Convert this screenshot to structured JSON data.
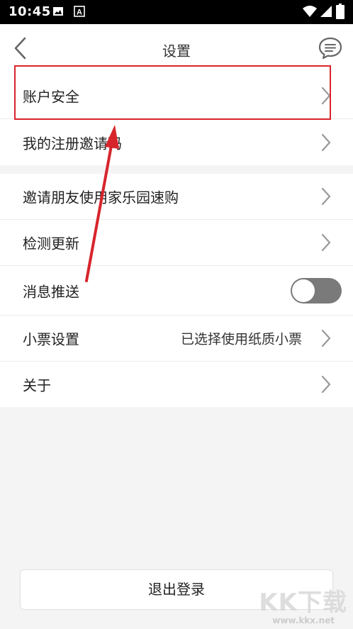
{
  "status_bar": {
    "time": "10:45",
    "icons": [
      "image-icon",
      "app-a-icon",
      "wifi-icon",
      "signal-icon",
      "battery-icon"
    ]
  },
  "header": {
    "title": "设置",
    "back_icon": "chevron-left-icon",
    "message_icon": "message-bubble-icon"
  },
  "settings": {
    "account_security": "账户安全",
    "invite_code": "我的注册邀请码",
    "invite_friends": "邀请朋友使用家乐园速购",
    "check_update": "检测更新",
    "push_notifications": "消息推送",
    "push_enabled": false,
    "receipt_settings": "小票设置",
    "receipt_value": "已选择使用纸质小票",
    "about": "关于"
  },
  "logout_label": "退出登录",
  "watermark": {
    "main": "KK下载",
    "sub": "www.kkx.net"
  },
  "colors": {
    "highlight": "#d8242c",
    "toggle_off": "#7a7a7a",
    "background": "#f4f4f4"
  }
}
